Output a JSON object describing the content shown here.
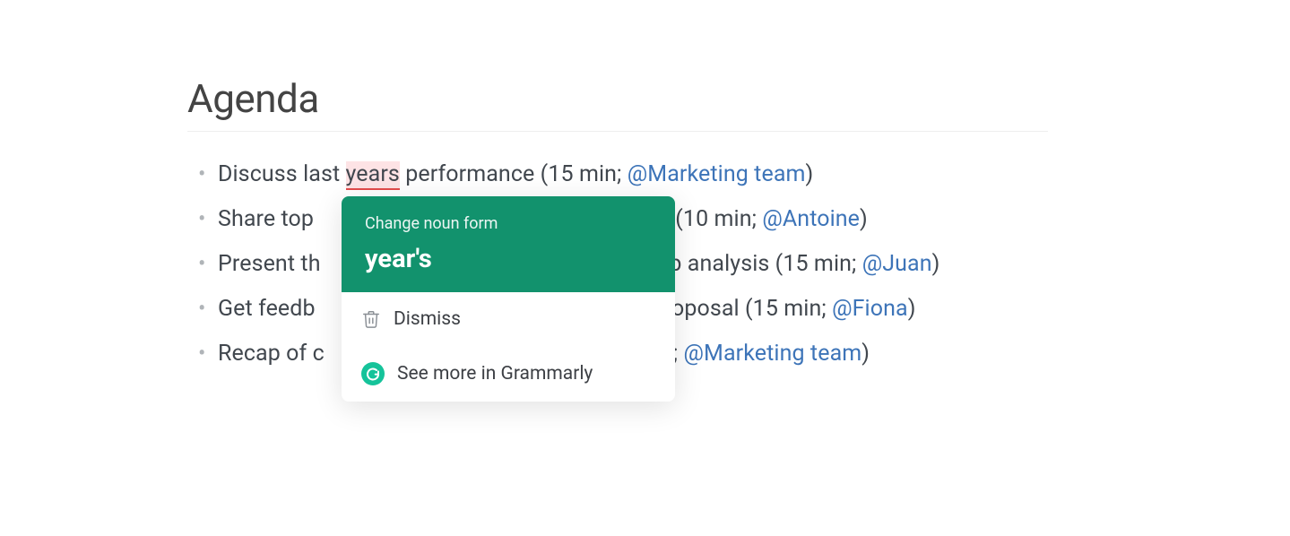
{
  "heading": "Agenda",
  "items": [
    {
      "pre": "Discuss last ",
      "err": "years",
      "mid": " performance (15 min; ",
      "mention": "@Marketing team",
      "post": ")"
    },
    {
      "pre": "Share top",
      "err": "",
      "mid": "m (10 min; ",
      "mention": "@Antoine",
      "post": ")"
    },
    {
      "pre": "Present th",
      "err": "",
      "mid": "ap analysis (15 min; ",
      "mention": "@Juan",
      "post": ")"
    },
    {
      "pre": "Get feedb",
      "err": "",
      "mid": "proposal (15 min; ",
      "mention": "@Fiona",
      "post": ")"
    },
    {
      "pre": "Recap of c",
      "err": "",
      "mid": "n; ",
      "mention": "@Marketing team",
      "post": ")"
    }
  ],
  "popup": {
    "title": "Change noun form",
    "suggestion": "year's",
    "dismiss": "Dismiss",
    "more": "See more in Grammarly"
  }
}
